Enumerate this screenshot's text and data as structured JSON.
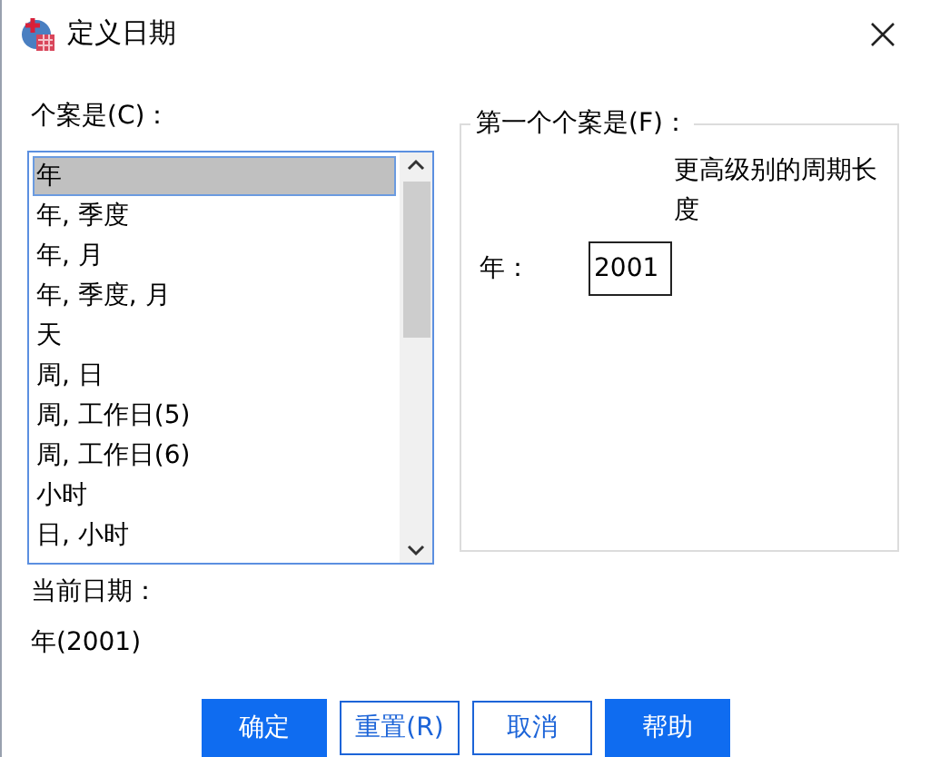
{
  "window": {
    "title": "定义日期"
  },
  "cases": {
    "label": "个案是(C)：",
    "items": [
      {
        "label": "年",
        "selected": true
      },
      {
        "label": "年, 季度",
        "selected": false
      },
      {
        "label": "年, 月",
        "selected": false
      },
      {
        "label": "年, 季度, 月",
        "selected": false
      },
      {
        "label": "天",
        "selected": false
      },
      {
        "label": "周, 日",
        "selected": false
      },
      {
        "label": "周, 工作日(5)",
        "selected": false
      },
      {
        "label": "周, 工作日(6)",
        "selected": false
      },
      {
        "label": "小时",
        "selected": false
      },
      {
        "label": "日, 小时",
        "selected": false
      }
    ]
  },
  "first_case": {
    "title": "第一个个案是(F)：",
    "column_header": "更高级别的周期长度",
    "fields": [
      {
        "label": "年：",
        "value": "2001"
      }
    ]
  },
  "current_date": {
    "label": "当前日期：",
    "value": "年(2001)"
  },
  "buttons": [
    {
      "label": "确定",
      "kind": "primary"
    },
    {
      "label": "重置(R)",
      "kind": "outline"
    },
    {
      "label": "取消",
      "kind": "outline"
    },
    {
      "label": "帮助",
      "kind": "primary"
    }
  ]
}
